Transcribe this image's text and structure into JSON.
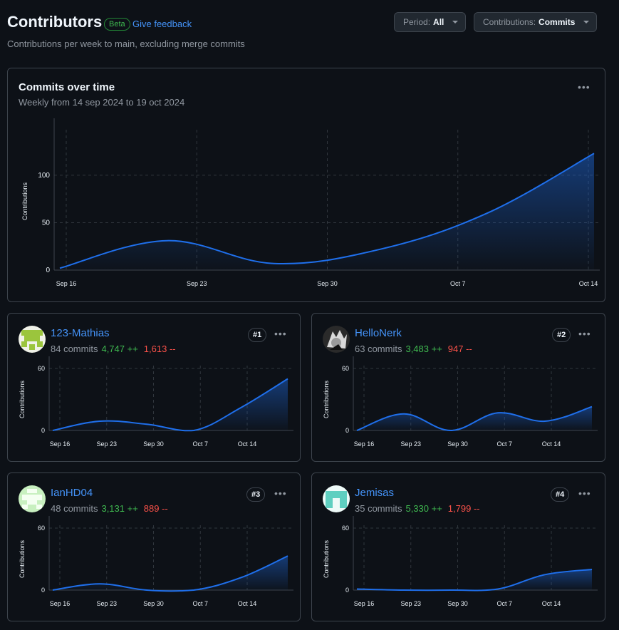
{
  "header": {
    "title": "Contributors",
    "beta_label": "Beta",
    "feedback_label": "Give feedback",
    "subtitle": "Contributions per week to main, excluding merge commits",
    "period_label": "Period:",
    "period_value": "All",
    "contrib_label": "Contributions:",
    "contrib_value": "Commits"
  },
  "main_chart": {
    "title": "Commits over time",
    "subtitle": "Weekly from 14 sep 2024 to 19 oct 2024"
  },
  "colors": {
    "accent": "#1f6feb",
    "link": "#4493f8",
    "add": "#3fb950",
    "del": "#f85149"
  },
  "contributors": [
    {
      "name": "123-Mathias",
      "commits": "84 commits",
      "additions": "4,747 ++",
      "deletions": "1,613 --",
      "rank": "#1",
      "avatar_icon": "identicon-green"
    },
    {
      "name": "HelloNerk",
      "commits": "63 commits",
      "additions": "3,483 ++",
      "deletions": "947 --",
      "rank": "#2",
      "avatar_icon": "photo-avatar"
    },
    {
      "name": "IanHD04",
      "commits": "48 commits",
      "additions": "3,131 ++",
      "deletions": "889 --",
      "rank": "#3",
      "avatar_icon": "identicon-light-green"
    },
    {
      "name": "Jemisas",
      "commits": "35 commits",
      "additions": "5,330 ++",
      "deletions": "1,799 --",
      "rank": "#4",
      "avatar_icon": "identicon-teal"
    }
  ],
  "chart_data": [
    {
      "type": "area",
      "title": "Commits over time",
      "ylabel": "Contributions",
      "xticks": [
        "Sep 16",
        "Sep 23",
        "Sep 30",
        "Oct 7",
        "Oct 14"
      ],
      "yticks": [
        0,
        50,
        100
      ],
      "ylim": [
        0,
        145
      ],
      "x": [
        "Sep 15",
        "Sep 22",
        "Sep 29",
        "Oct 6",
        "Oct 13",
        "Oct 20"
      ],
      "values": [
        2,
        31,
        7,
        22,
        60,
        123
      ],
      "grid": true
    },
    {
      "type": "area",
      "series_name": "123-Mathias",
      "ylabel": "Contributions",
      "xticks": [
        "Sep 16",
        "Sep 23",
        "Sep 30",
        "Oct 7",
        "Oct 14"
      ],
      "yticks": [
        0,
        60
      ],
      "ylim": [
        0,
        60
      ],
      "x": [
        "Sep 15",
        "Sep 22",
        "Sep 29",
        "Oct 6",
        "Oct 13",
        "Oct 20"
      ],
      "values": [
        0,
        9,
        6,
        0,
        22,
        50
      ]
    },
    {
      "type": "area",
      "series_name": "HelloNerk",
      "ylabel": "Contributions",
      "xticks": [
        "Sep 16",
        "Sep 23",
        "Sep 30",
        "Oct 7",
        "Oct 14"
      ],
      "yticks": [
        0,
        60
      ],
      "ylim": [
        0,
        60
      ],
      "x": [
        "Sep 15",
        "Sep 22",
        "Sep 29",
        "Oct 6",
        "Oct 13",
        "Oct 20"
      ],
      "values": [
        0,
        16,
        0,
        17,
        9,
        23
      ]
    },
    {
      "type": "area",
      "series_name": "IanHD04",
      "ylabel": "Contributions",
      "xticks": [
        "Sep 16",
        "Sep 23",
        "Sep 30",
        "Oct 7",
        "Oct 14"
      ],
      "yticks": [
        0,
        60
      ],
      "ylim": [
        0,
        60
      ],
      "x": [
        "Sep 15",
        "Sep 22",
        "Sep 29",
        "Oct 6",
        "Oct 13",
        "Oct 20"
      ],
      "values": [
        0,
        6,
        0,
        0,
        12,
        33
      ]
    },
    {
      "type": "area",
      "series_name": "Jemisas",
      "ylabel": "Contributions",
      "xticks": [
        "Sep 16",
        "Sep 23",
        "Sep 30",
        "Oct 7",
        "Oct 14"
      ],
      "yticks": [
        0,
        60
      ],
      "ylim": [
        0,
        60
      ],
      "x": [
        "Sep 15",
        "Sep 22",
        "Sep 29",
        "Oct 6",
        "Oct 13",
        "Oct 20"
      ],
      "values": [
        1,
        0,
        0,
        1,
        15,
        20
      ]
    }
  ]
}
